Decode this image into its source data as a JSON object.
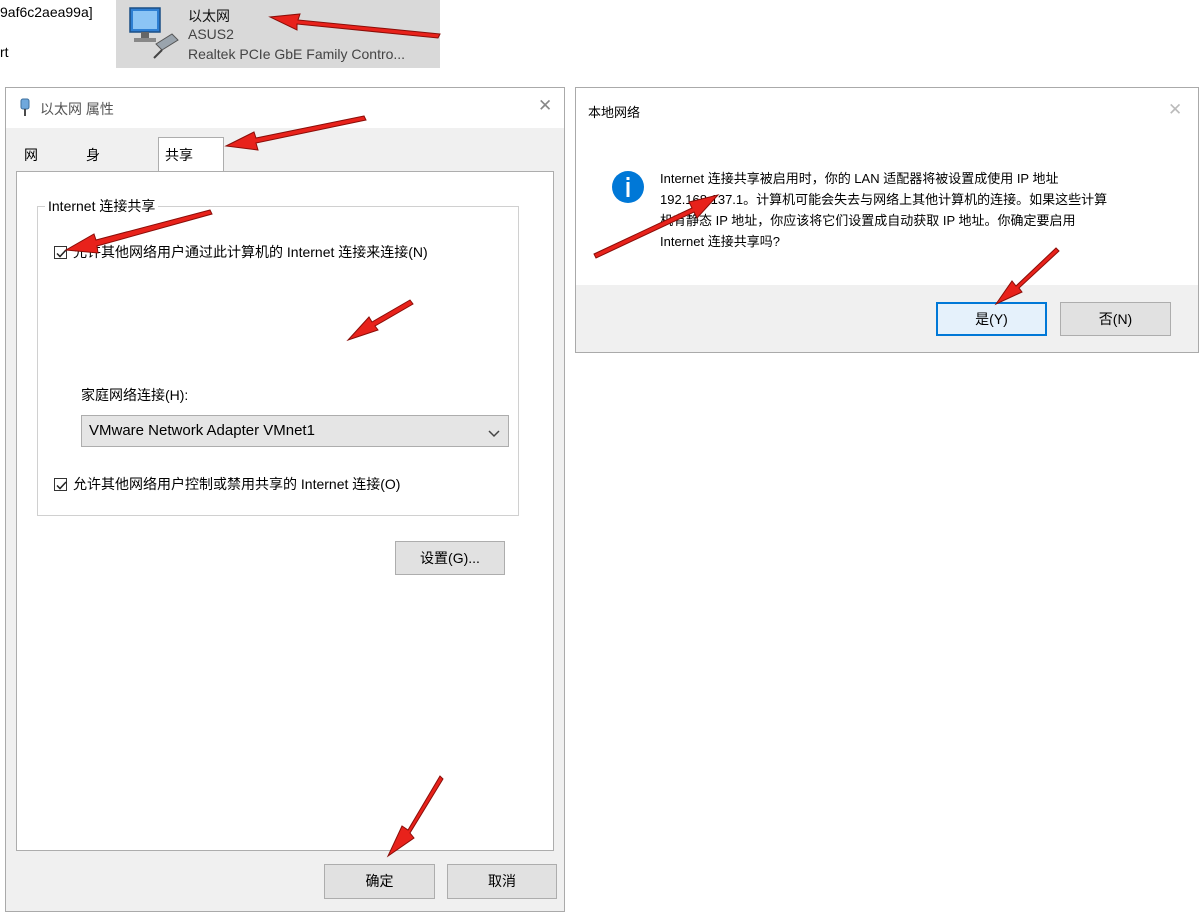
{
  "top_strip": {
    "partial_line_1": "9af6c2aea99a]",
    "partial_line_2": "rt",
    "adapter": {
      "name": "以太网",
      "line1": "ASUS2",
      "line2": "Realtek PCIe GbE Family Contro...",
      "icon": "network-adapter-icon"
    }
  },
  "properties_window": {
    "title": "以太网 属性",
    "title_icon": "network-plug-icon",
    "tabs": [
      {
        "label": "网络",
        "active": false
      },
      {
        "label": "身份验证",
        "active": false
      },
      {
        "label": "共享",
        "active": true
      }
    ],
    "group_title": "Internet 连接共享",
    "allow_share": {
      "label": "允许其他网络用户通过此计算机的 Internet 连接来连接(N)",
      "checked": true
    },
    "home_network_label": "家庭网络连接(H):",
    "home_network_value": "VMware Network Adapter VMnet1",
    "allow_control": {
      "label": "允许其他网络用户控制或禁用共享的 Internet 连接(O)",
      "checked": true
    },
    "settings_button": "设置(G)...",
    "ok_button": "确定",
    "cancel_button": "取消"
  },
  "confirm_dialog": {
    "title": "本地网络",
    "icon": "info-icon",
    "message_lines": [
      "Internet 连接共享被启用时，你的 LAN 适配器将被设置成使用 IP 地址",
      "192.168.137.1。计算机可能会失去与网络上其他计算机的连接。如果这些计算",
      "机有静态 IP 地址，你应该将它们设置成自动获取 IP 地址。你确定要启用",
      "Internet 连接共享吗?"
    ],
    "yes_button": "是(Y)",
    "no_button": "否(N)"
  },
  "colors": {
    "annotation_arrow": "#e8221b",
    "info_blue": "#0078d7",
    "window_bg": "#f0f0f0"
  }
}
